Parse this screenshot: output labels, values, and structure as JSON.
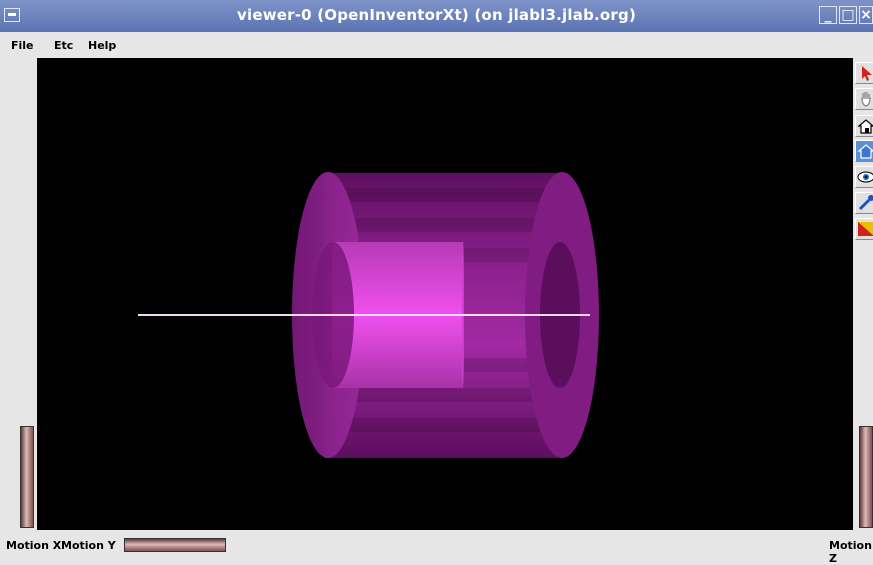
{
  "window": {
    "title": "viewer-0 (OpenInventorXt) (on jlabl3.jlab.org)"
  },
  "menu": {
    "items": [
      "File",
      "Etc",
      "Help"
    ]
  },
  "tools": [
    {
      "name": "select-arrow-icon"
    },
    {
      "name": "hand-view-icon"
    },
    {
      "name": "home-icon"
    },
    {
      "name": "set-home-icon"
    },
    {
      "name": "view-all-eye-icon"
    },
    {
      "name": "seek-icon"
    },
    {
      "name": "projection-toggle-icon"
    }
  ],
  "bottom": {
    "motion_x": "Motion X",
    "motion_y": "Motion Y",
    "motion_z": "Motion Z"
  },
  "colors": {
    "outer_cylinder": "#8a1e8c",
    "inner_cylinder": "#e84fe6",
    "background": "#000000",
    "axis_line": "#ffffff"
  }
}
